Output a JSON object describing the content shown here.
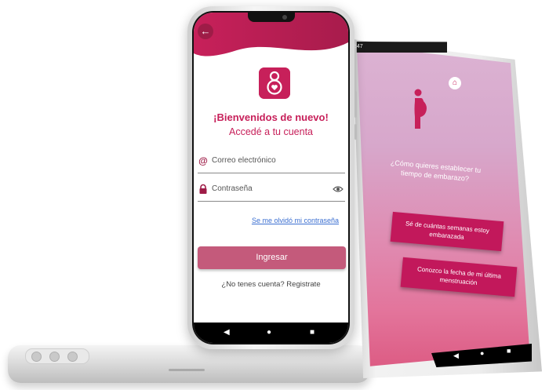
{
  "front_screen": {
    "back_icon": "arrow-left-icon",
    "logo_icon": "pregnancy-logo-icon",
    "welcome_title": "¡Bienvenidos de nuevo!",
    "welcome_subtitle": "Accedé a tu cuenta",
    "email": {
      "icon": "at-icon",
      "placeholder": "Correo electrónico"
    },
    "password": {
      "icon": "lock-icon",
      "placeholder": "Contraseña",
      "toggle_icon": "eye-icon"
    },
    "forgot_password": "Se me olvidó mi contraseña",
    "submit_label": "Ingresar",
    "register_text": "¿No tenes cuenta? Registrate",
    "nav": {
      "back": "◀",
      "home": "●",
      "recents": "■"
    }
  },
  "right_screen": {
    "status_time": "2:47",
    "home_icon": "home-icon",
    "figure_icon": "pregnant-woman-icon",
    "question": "¿Cómo quieres establecer tu tiempo de embarazo?",
    "options": [
      "Sé de cuántas semanas estoy embarazada",
      "Conozco la fecha de mi última menstruación"
    ],
    "nav": {
      "back": "◀",
      "home": "●",
      "recents": "■"
    }
  },
  "colors": {
    "brand": "#c7205a",
    "brand_dark": "#9e1c47",
    "button_muted": "#c45a7b",
    "link": "#3b6fd1",
    "gradient_top": "#dcb3d3",
    "gradient_bottom": "#dc5a82"
  }
}
